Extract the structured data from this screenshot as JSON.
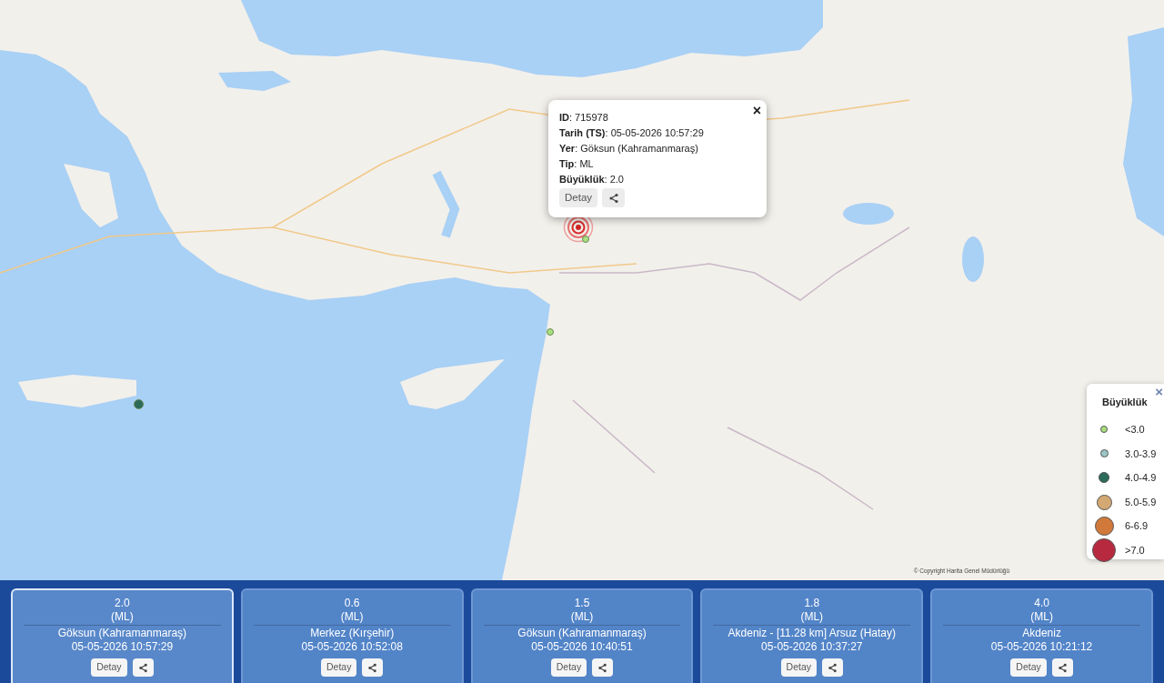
{
  "map": {
    "markers": [
      {
        "color": "#a8e07e",
        "selected": true
      },
      {
        "color": "#a8e07e",
        "selected": false
      },
      {
        "color": "#2c6a5a",
        "selected": false
      }
    ],
    "attribution": "© Copyright Harita Genel Müdürlüğü"
  },
  "popup": {
    "close": "×",
    "fields": [
      "**ID**: 715978",
      "**Tarih (TS)**: 05-05-2026 10:57:29",
      "**Yer**: Göksun (Kahramanmaraş)",
      "**Tip**: ML",
      "**Büyüklük**: 2.0"
    ],
    "detail": "Detay"
  },
  "legend": {
    "title": "Büyüklük",
    "close": "×",
    "items": [
      {
        "label": "<3.0",
        "color": "#a8e07e"
      },
      {
        "label": "3.0-3.9",
        "color": "#9cc6c6"
      },
      {
        "label": "4.0-4.9",
        "color": "#2c6a5a"
      },
      {
        "label": "5.0-5.9",
        "color": "#d3a873"
      },
      {
        "label": "6-6.9",
        "color": "#d0793a"
      },
      {
        "label": ">7.0",
        "color": "#b7293f"
      }
    ]
  },
  "events": [
    {
      "magnitude": "2.0",
      "type": "(ML)",
      "location": "Göksun (Kahramanmaraş)",
      "time": "05-05-2026 10:57:29",
      "detail": "Detay",
      "selected": true
    },
    {
      "magnitude": "0.6",
      "type": "(ML)",
      "location": "Merkez (Kırşehir)",
      "time": "05-05-2026 10:52:08",
      "detail": "Detay",
      "selected": false
    },
    {
      "magnitude": "1.5",
      "type": "(ML)",
      "location": "Göksun (Kahramanmaraş)",
      "time": "05-05-2026 10:40:51",
      "detail": "Detay",
      "selected": false
    },
    {
      "magnitude": "1.8",
      "type": "(ML)",
      "location": "Akdeniz - [11.28 km] Arsuz (Hatay)",
      "time": "05-05-2026 10:37:27",
      "detail": "Detay",
      "selected": false
    },
    {
      "magnitude": "4.0",
      "type": "(ML)",
      "location": "Akdeniz",
      "time": "05-05-2026 10:21:12",
      "detail": "Detay",
      "selected": false
    }
  ]
}
